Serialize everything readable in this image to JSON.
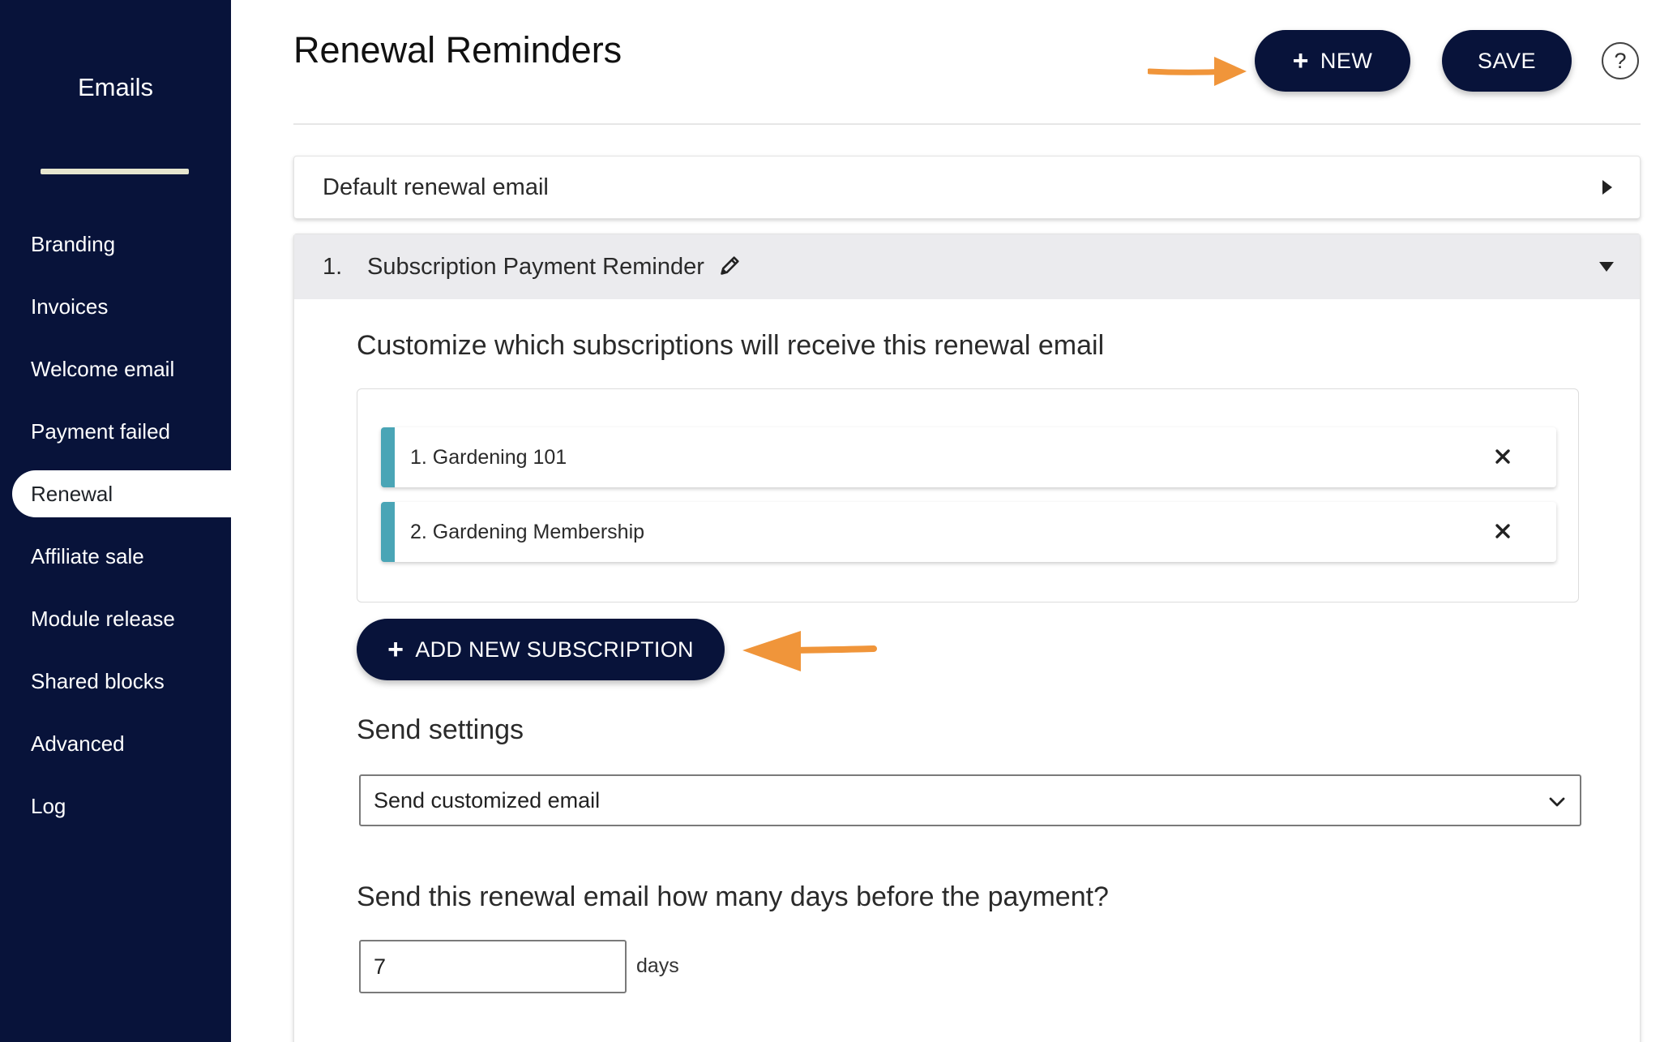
{
  "sidebar": {
    "title": "Emails",
    "items": [
      {
        "label": "Branding"
      },
      {
        "label": "Invoices"
      },
      {
        "label": "Welcome email"
      },
      {
        "label": "Payment failed"
      },
      {
        "label": "Renewal",
        "active": true
      },
      {
        "label": "Affiliate sale"
      },
      {
        "label": "Module release"
      },
      {
        "label": "Shared blocks"
      },
      {
        "label": "Advanced"
      },
      {
        "label": "Log"
      }
    ]
  },
  "header": {
    "title": "Renewal Reminders",
    "new_label": "NEW",
    "save_label": "SAVE",
    "help_label": "?"
  },
  "accordion": {
    "default_label": "Default renewal email",
    "reminder": {
      "index": "1.",
      "name": "Subscription Payment Reminder"
    }
  },
  "subscriptions": {
    "title": "Customize which subscriptions will receive this renewal email",
    "items": [
      {
        "label": "1. Gardening 101"
      },
      {
        "label": "2. Gardening Membership"
      }
    ],
    "add_label": "ADD NEW SUBSCRIPTION"
  },
  "send_settings": {
    "title": "Send settings",
    "selected": "Send customized email"
  },
  "days": {
    "question": "Send this renewal email how many days before the payment?",
    "value": "7",
    "unit": "days"
  },
  "colors": {
    "sidebar_bg": "#08133a",
    "button_bg": "#08133a",
    "accent_teal": "#4aa5b6",
    "arrow_orange": "#f0953a"
  },
  "icons": {
    "edit": "pencil-icon",
    "remove": "close-icon",
    "expand": "caret-right-icon",
    "collapse": "caret-down-icon",
    "select": "chevron-down-icon",
    "help": "help-icon",
    "add": "plus-icon"
  }
}
